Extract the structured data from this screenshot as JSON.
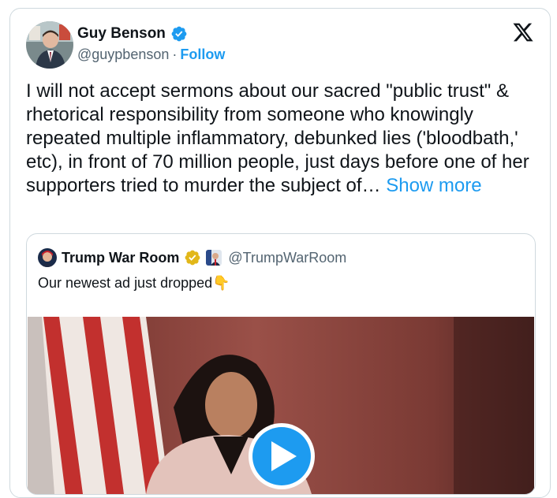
{
  "author": {
    "name": "Guy Benson",
    "handle": "@guypbenson",
    "separator": "·",
    "follow_label": "Follow"
  },
  "tweet": {
    "text": "I will not accept sermons about our sacred \"public trust\" & rhetorical responsibility from someone who knowingly repeated multiple inflammatory, debunked lies ('bloodbath,' etc), in front of 70 million people, just days before one of her supporters tried to murder the subject of…",
    "show_more_label": "Show more"
  },
  "quoted": {
    "name": "Trump War Room",
    "handle": "@TrumpWarRoom",
    "text": "Our newest ad just dropped",
    "emoji": "👇"
  },
  "colors": {
    "accent": "#1d9bf0",
    "text": "#0f1419",
    "secondary": "#536471",
    "border": "#cfd9de",
    "gold_badge": "#e2b719"
  },
  "icons": {
    "verified": "blue-check-icon",
    "gold_verified": "gold-check-icon",
    "brand": "x-logo-icon",
    "play": "play-icon"
  }
}
